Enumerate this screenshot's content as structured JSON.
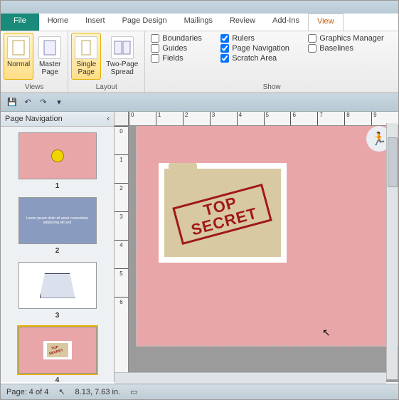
{
  "tabs": {
    "file": "File",
    "items": [
      "Home",
      "Insert",
      "Page Design",
      "Mailings",
      "Review",
      "Add-Ins",
      "View"
    ],
    "active": "View"
  },
  "ribbon": {
    "views": {
      "label": "Views",
      "normal": "Normal",
      "master": "Master\nPage"
    },
    "layout": {
      "label": "Layout",
      "single": "Single\nPage",
      "two": "Two-Page\nSpread"
    },
    "show": {
      "label": "Show",
      "boundaries": "Boundaries",
      "guides": "Guides",
      "fields": "Fields",
      "rulers": "Rulers",
      "pagenav": "Page Navigation",
      "scratch": "Scratch Area",
      "graphics": "Graphics Manager",
      "baselines": "Baselines",
      "checked": {
        "boundaries": false,
        "guides": false,
        "fields": false,
        "rulers": true,
        "pagenav": true,
        "scratch": true,
        "graphics": false,
        "baselines": false
      }
    }
  },
  "nav": {
    "title": "Page Navigation",
    "pages": [
      "1",
      "2",
      "3",
      "4"
    ],
    "selected": 4
  },
  "canvas": {
    "stamp_line1": "TOP",
    "stamp_line2": "SECRET",
    "ruler_h": [
      "0",
      "1",
      "2",
      "3",
      "4",
      "5",
      "6",
      "7",
      "8",
      "9"
    ],
    "ruler_v": [
      "0",
      "1",
      "2",
      "3",
      "4",
      "5",
      "6"
    ]
  },
  "status": {
    "page": "Page: 4 of 4",
    "coords": "8.13, 7.63 in."
  }
}
